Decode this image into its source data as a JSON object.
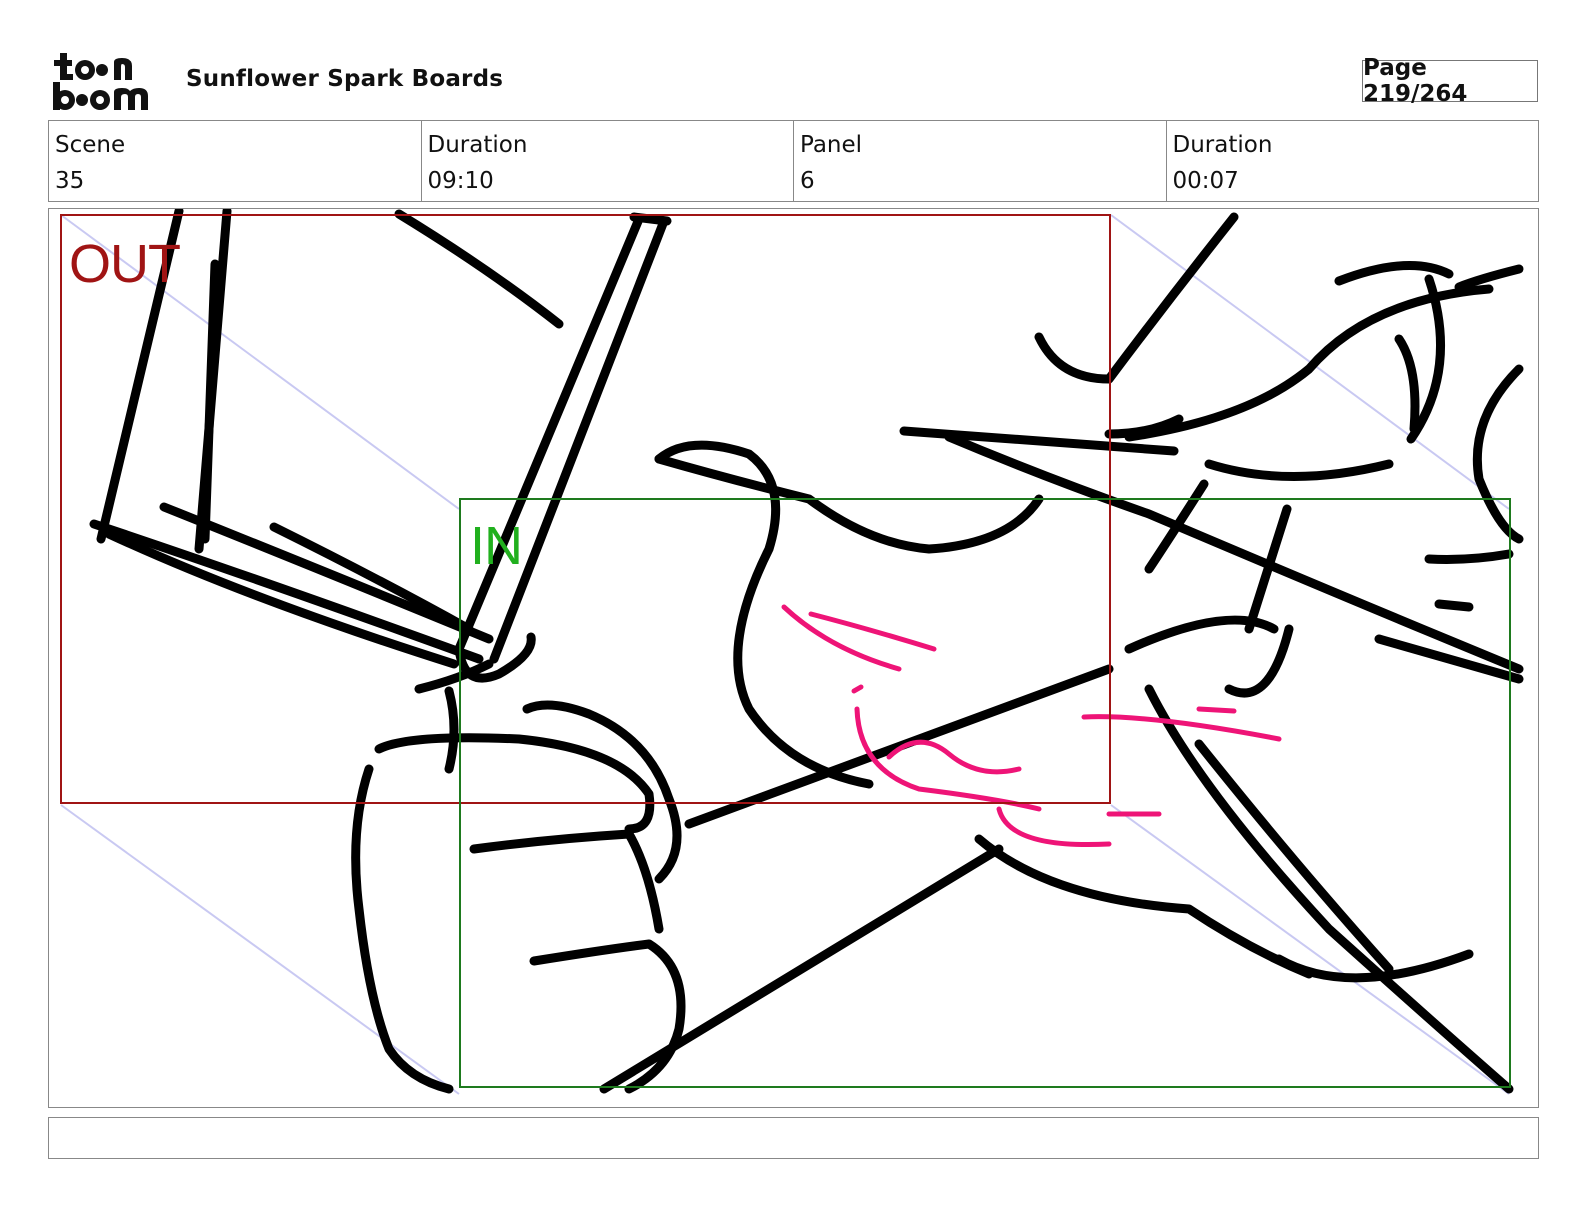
{
  "header": {
    "logo_icon": "toon-boom-logo",
    "logo_text": "toon boom",
    "project_title": "Sunflower Spark Boards",
    "page_label": "Page 219/264"
  },
  "info_table": {
    "cells": [
      {
        "label": "Scene",
        "value": "35"
      },
      {
        "label": "Duration",
        "value": "09:10"
      },
      {
        "label": "Panel",
        "value": "6"
      },
      {
        "label": "Duration",
        "value": "00:07"
      }
    ]
  },
  "panel": {
    "out_label": "OUT",
    "in_label": "IN",
    "out_frame_color": "#a01414",
    "in_frame_color": "#1e7a1e",
    "sketch_color": "#000000",
    "accent_stroke_color": "#ee1477",
    "motion_path_color": "#c9c9f2"
  },
  "notes": {
    "text": ""
  }
}
